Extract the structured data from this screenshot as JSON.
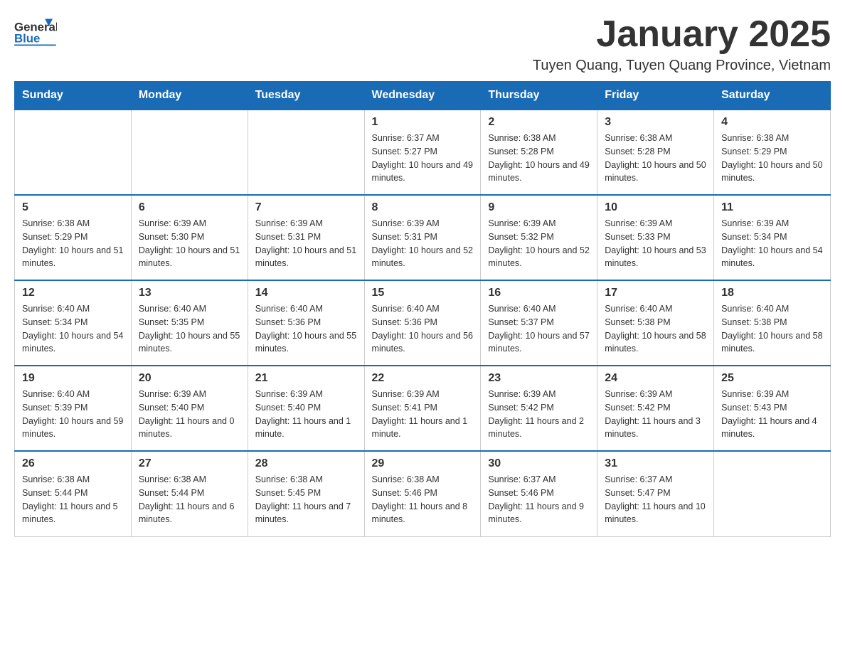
{
  "header": {
    "logo_general": "General",
    "logo_blue": "Blue",
    "title": "January 2025",
    "subtitle": "Tuyen Quang, Tuyen Quang Province, Vietnam"
  },
  "days_of_week": [
    "Sunday",
    "Monday",
    "Tuesday",
    "Wednesday",
    "Thursday",
    "Friday",
    "Saturday"
  ],
  "weeks": [
    [
      {
        "day": "",
        "info": ""
      },
      {
        "day": "",
        "info": ""
      },
      {
        "day": "",
        "info": ""
      },
      {
        "day": "1",
        "info": "Sunrise: 6:37 AM\nSunset: 5:27 PM\nDaylight: 10 hours and 49 minutes."
      },
      {
        "day": "2",
        "info": "Sunrise: 6:38 AM\nSunset: 5:28 PM\nDaylight: 10 hours and 49 minutes."
      },
      {
        "day": "3",
        "info": "Sunrise: 6:38 AM\nSunset: 5:28 PM\nDaylight: 10 hours and 50 minutes."
      },
      {
        "day": "4",
        "info": "Sunrise: 6:38 AM\nSunset: 5:29 PM\nDaylight: 10 hours and 50 minutes."
      }
    ],
    [
      {
        "day": "5",
        "info": "Sunrise: 6:38 AM\nSunset: 5:29 PM\nDaylight: 10 hours and 51 minutes."
      },
      {
        "day": "6",
        "info": "Sunrise: 6:39 AM\nSunset: 5:30 PM\nDaylight: 10 hours and 51 minutes."
      },
      {
        "day": "7",
        "info": "Sunrise: 6:39 AM\nSunset: 5:31 PM\nDaylight: 10 hours and 51 minutes."
      },
      {
        "day": "8",
        "info": "Sunrise: 6:39 AM\nSunset: 5:31 PM\nDaylight: 10 hours and 52 minutes."
      },
      {
        "day": "9",
        "info": "Sunrise: 6:39 AM\nSunset: 5:32 PM\nDaylight: 10 hours and 52 minutes."
      },
      {
        "day": "10",
        "info": "Sunrise: 6:39 AM\nSunset: 5:33 PM\nDaylight: 10 hours and 53 minutes."
      },
      {
        "day": "11",
        "info": "Sunrise: 6:39 AM\nSunset: 5:34 PM\nDaylight: 10 hours and 54 minutes."
      }
    ],
    [
      {
        "day": "12",
        "info": "Sunrise: 6:40 AM\nSunset: 5:34 PM\nDaylight: 10 hours and 54 minutes."
      },
      {
        "day": "13",
        "info": "Sunrise: 6:40 AM\nSunset: 5:35 PM\nDaylight: 10 hours and 55 minutes."
      },
      {
        "day": "14",
        "info": "Sunrise: 6:40 AM\nSunset: 5:36 PM\nDaylight: 10 hours and 55 minutes."
      },
      {
        "day": "15",
        "info": "Sunrise: 6:40 AM\nSunset: 5:36 PM\nDaylight: 10 hours and 56 minutes."
      },
      {
        "day": "16",
        "info": "Sunrise: 6:40 AM\nSunset: 5:37 PM\nDaylight: 10 hours and 57 minutes."
      },
      {
        "day": "17",
        "info": "Sunrise: 6:40 AM\nSunset: 5:38 PM\nDaylight: 10 hours and 58 minutes."
      },
      {
        "day": "18",
        "info": "Sunrise: 6:40 AM\nSunset: 5:38 PM\nDaylight: 10 hours and 58 minutes."
      }
    ],
    [
      {
        "day": "19",
        "info": "Sunrise: 6:40 AM\nSunset: 5:39 PM\nDaylight: 10 hours and 59 minutes."
      },
      {
        "day": "20",
        "info": "Sunrise: 6:39 AM\nSunset: 5:40 PM\nDaylight: 11 hours and 0 minutes."
      },
      {
        "day": "21",
        "info": "Sunrise: 6:39 AM\nSunset: 5:40 PM\nDaylight: 11 hours and 1 minute."
      },
      {
        "day": "22",
        "info": "Sunrise: 6:39 AM\nSunset: 5:41 PM\nDaylight: 11 hours and 1 minute."
      },
      {
        "day": "23",
        "info": "Sunrise: 6:39 AM\nSunset: 5:42 PM\nDaylight: 11 hours and 2 minutes."
      },
      {
        "day": "24",
        "info": "Sunrise: 6:39 AM\nSunset: 5:42 PM\nDaylight: 11 hours and 3 minutes."
      },
      {
        "day": "25",
        "info": "Sunrise: 6:39 AM\nSunset: 5:43 PM\nDaylight: 11 hours and 4 minutes."
      }
    ],
    [
      {
        "day": "26",
        "info": "Sunrise: 6:38 AM\nSunset: 5:44 PM\nDaylight: 11 hours and 5 minutes."
      },
      {
        "day": "27",
        "info": "Sunrise: 6:38 AM\nSunset: 5:44 PM\nDaylight: 11 hours and 6 minutes."
      },
      {
        "day": "28",
        "info": "Sunrise: 6:38 AM\nSunset: 5:45 PM\nDaylight: 11 hours and 7 minutes."
      },
      {
        "day": "29",
        "info": "Sunrise: 6:38 AM\nSunset: 5:46 PM\nDaylight: 11 hours and 8 minutes."
      },
      {
        "day": "30",
        "info": "Sunrise: 6:37 AM\nSunset: 5:46 PM\nDaylight: 11 hours and 9 minutes."
      },
      {
        "day": "31",
        "info": "Sunrise: 6:37 AM\nSunset: 5:47 PM\nDaylight: 11 hours and 10 minutes."
      },
      {
        "day": "",
        "info": ""
      }
    ]
  ]
}
